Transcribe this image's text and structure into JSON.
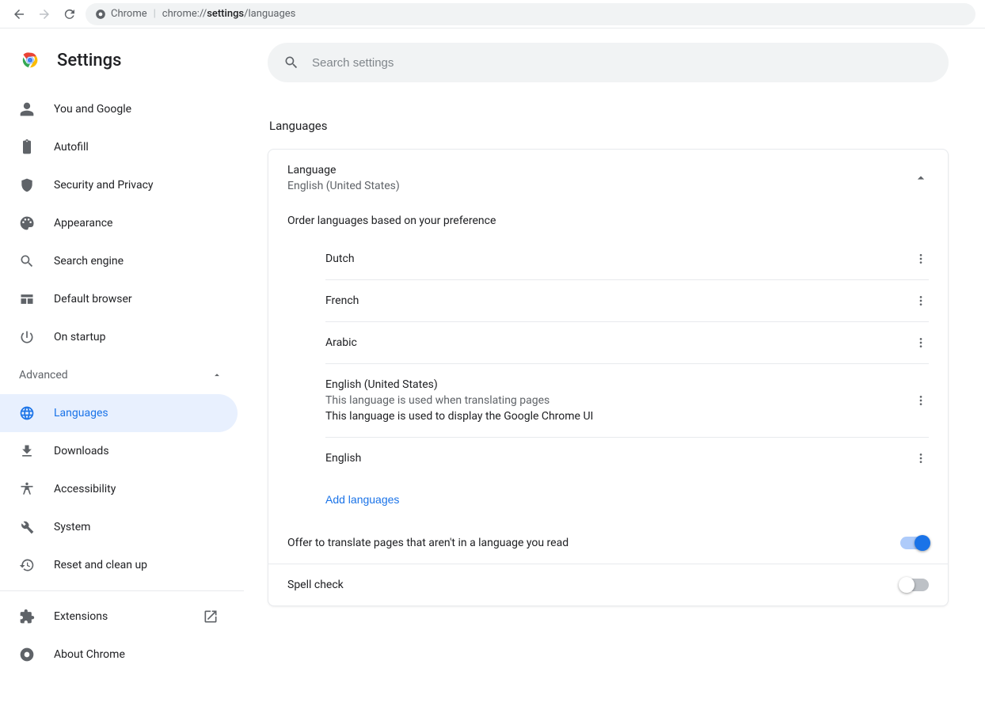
{
  "browser": {
    "site_label": "Chrome",
    "url_prefix": "chrome://",
    "url_strong": "settings",
    "url_suffix": "/languages"
  },
  "header": {
    "title": "Settings"
  },
  "search": {
    "placeholder": "Search settings"
  },
  "sidebar": {
    "advanced_label": "Advanced",
    "items_basic": [
      {
        "label": "You and Google",
        "icon": "person"
      },
      {
        "label": "Autofill",
        "icon": "clipboard"
      },
      {
        "label": "Security and Privacy",
        "icon": "shield"
      },
      {
        "label": "Appearance",
        "icon": "palette"
      },
      {
        "label": "Search engine",
        "icon": "search"
      },
      {
        "label": "Default browser",
        "icon": "browser"
      },
      {
        "label": "On startup",
        "icon": "power"
      }
    ],
    "items_advanced": [
      {
        "label": "Languages",
        "icon": "globe",
        "selected": true
      },
      {
        "label": "Downloads",
        "icon": "download"
      },
      {
        "label": "Accessibility",
        "icon": "accessibility"
      },
      {
        "label": "System",
        "icon": "wrench"
      },
      {
        "label": "Reset and clean up",
        "icon": "restore"
      }
    ],
    "items_footer": [
      {
        "label": "Extensions",
        "icon": "extension",
        "external": true
      },
      {
        "label": "About Chrome",
        "icon": "chrome"
      }
    ]
  },
  "page": {
    "section_title": "Languages",
    "language_card": {
      "title": "Language",
      "current": "English (United States)",
      "instruction": "Order languages based on your preference",
      "languages": [
        {
          "name": "Dutch"
        },
        {
          "name": "French"
        },
        {
          "name": "Arabic"
        },
        {
          "name": "English (United States)",
          "sub": "This language is used when translating pages",
          "text": "This language is used to display the Google Chrome UI"
        },
        {
          "name": "English"
        }
      ],
      "add_label": "Add languages"
    },
    "translate_row": {
      "label": "Offer to translate pages that aren't in a language you read",
      "on": true
    },
    "spellcheck_row": {
      "label": "Spell check",
      "on": false
    }
  }
}
